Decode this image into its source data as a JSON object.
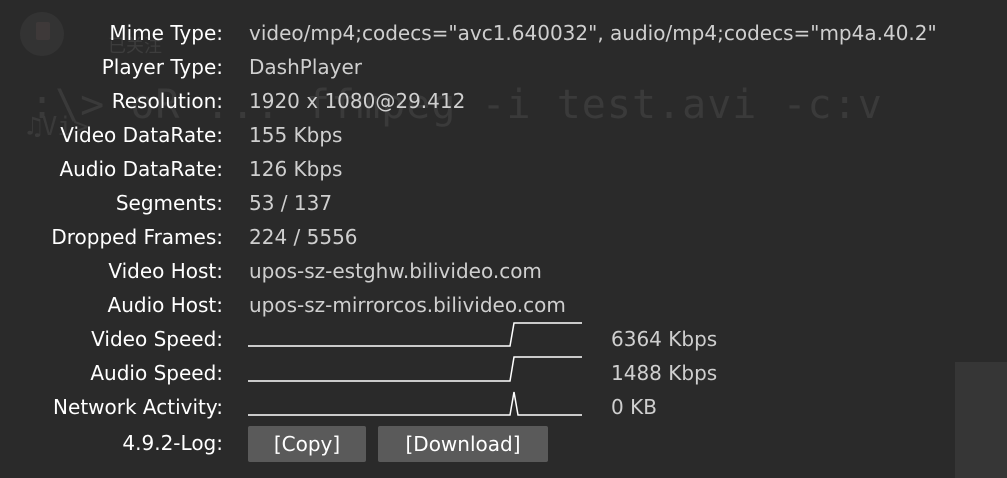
{
  "background": {
    "chinese_text": "已关注",
    "command_text": ":\\> oR ... ffmpeg -i test.avi -c:v",
    "command_text_2": "♫Vi>"
  },
  "stats": {
    "mime_type": {
      "label": "Mime Type:",
      "value": "video/mp4;codecs=\"avc1.640032\", audio/mp4;codecs=\"mp4a.40.2\""
    },
    "player_type": {
      "label": "Player Type:",
      "value": "DashPlayer"
    },
    "resolution": {
      "label": "Resolution:",
      "value": "1920 x 1080@29.412"
    },
    "video_datarate": {
      "label": "Video DataRate:",
      "value": "155 Kbps"
    },
    "audio_datarate": {
      "label": "Audio DataRate:",
      "value": "126 Kbps"
    },
    "segments": {
      "label": "Segments:",
      "value": "53 / 137"
    },
    "dropped_frames": {
      "label": "Dropped Frames:",
      "value": "224 / 5556"
    },
    "video_host": {
      "label": "Video Host:",
      "value": "upos-sz-estghw.bilivideo.com"
    },
    "audio_host": {
      "label": "Audio Host:",
      "value": "upos-sz-mirrorcos.bilivideo.com"
    },
    "video_speed": {
      "label": "Video Speed:",
      "value": "6364 Kbps"
    },
    "audio_speed": {
      "label": "Audio Speed:",
      "value": "1488 Kbps"
    },
    "network_activity": {
      "label": "Network Activity:",
      "value": "0 KB"
    },
    "log": {
      "label": "4.9.2-Log:",
      "copy_label": "[Copy]",
      "download_label": "[Download]"
    }
  },
  "colors": {
    "background": "#2a2a2a",
    "label": "#ffffff",
    "value": "#cfcfcf",
    "graph_line": "#ffffff",
    "button_bg": "#5a5a5a"
  }
}
